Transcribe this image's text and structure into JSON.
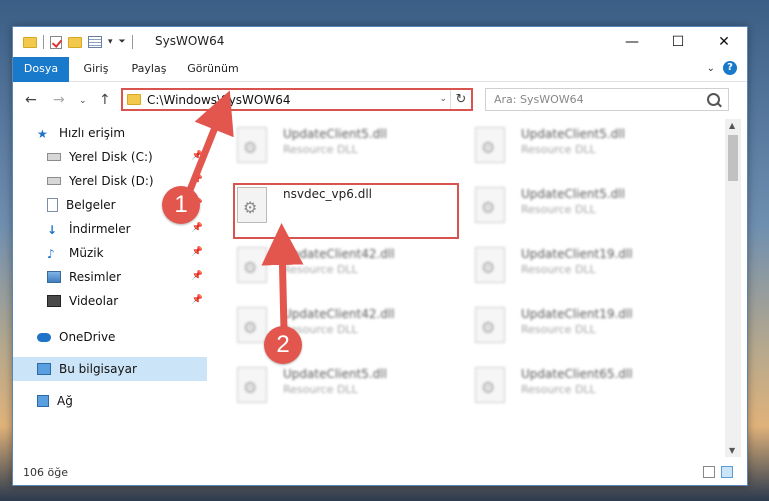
{
  "window": {
    "title": "SysWOW64",
    "controls": [
      "—",
      "☐",
      "✕"
    ]
  },
  "ribbon": {
    "tabs": [
      "Dosya",
      "Giriş",
      "Paylaş",
      "Görünüm"
    ],
    "expand": "⌄",
    "help": "?"
  },
  "nav": {
    "back": "←",
    "forward": "→",
    "recent": "⌄",
    "up": "↑"
  },
  "address": {
    "path": "C:\\Windows\\SysWOW64",
    "dropdown": "⌄",
    "refresh": "↻"
  },
  "search": {
    "placeholder": "Ara: SysWOW64"
  },
  "sidebar": {
    "items": [
      {
        "label": "Hızlı erişim",
        "icon": "star-icon"
      },
      {
        "label": "Yerel Disk (C:)",
        "icon": "drive-icon",
        "pinned": true
      },
      {
        "label": "Yerel Disk (D:)",
        "icon": "drive-icon",
        "pinned": true
      },
      {
        "label": "Belgeler",
        "icon": "document-icon",
        "pinned": true
      },
      {
        "label": "İndirmeler",
        "icon": "download-icon",
        "pinned": true
      },
      {
        "label": "Müzik",
        "icon": "music-icon",
        "pinned": true
      },
      {
        "label": "Resimler",
        "icon": "picture-icon",
        "pinned": true
      },
      {
        "label": "Videolar",
        "icon": "video-icon",
        "pinned": true
      },
      {
        "label": "OneDrive",
        "icon": "cloud-icon"
      },
      {
        "label": "Bu bilgisayar",
        "icon": "computer-icon",
        "selected": true
      },
      {
        "label": "Ağ",
        "icon": "network-icon"
      }
    ]
  },
  "files": {
    "highlighted": {
      "name": "nsvdec_vp6.dll"
    },
    "items": [
      {
        "name": "UpdateClient5.dll",
        "type": "Resource DLL"
      },
      {
        "name": "UpdateClient5.dll",
        "type": "Resource DLL"
      },
      {
        "name": "UpdateClient5.dll",
        "type": "Resource DLL"
      },
      {
        "name": "UpdateClient42.dll",
        "type": "Resource DLL"
      },
      {
        "name": "UpdateClient19.dll",
        "type": "Resource DLL"
      },
      {
        "name": "UpdateClient42.dll",
        "type": "Resource DLL"
      },
      {
        "name": "UpdateClient19.dll",
        "type": "Resource DLL"
      },
      {
        "name": "UpdateClient5.dll",
        "type": "Resource DLL"
      },
      {
        "name": "UpdateClient65.dll",
        "type": "Resource DLL"
      }
    ]
  },
  "status": {
    "count": "106 öğe"
  },
  "annotations": {
    "step1": "1",
    "step2": "2",
    "color": "#e2564d"
  }
}
